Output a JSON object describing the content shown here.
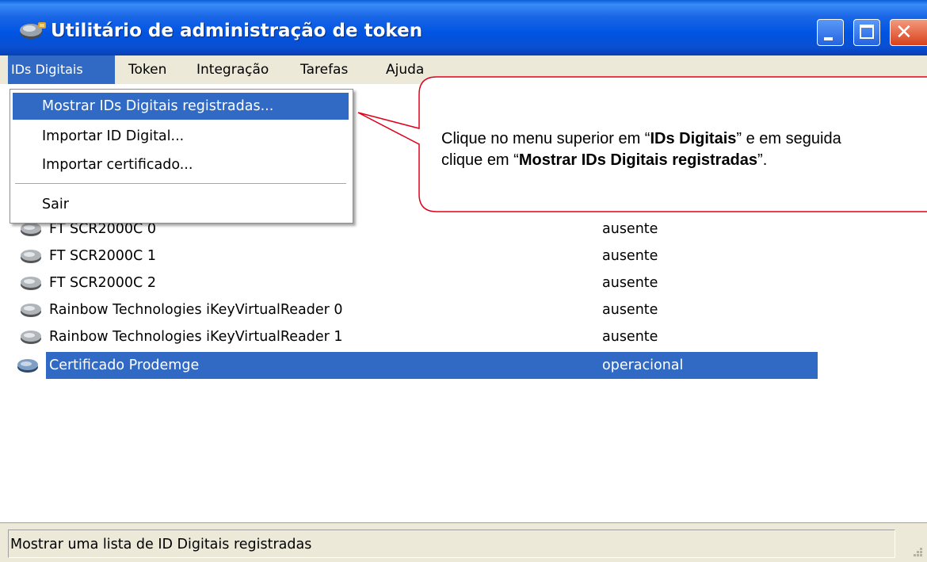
{
  "window": {
    "title": "Utilitário de administração de token"
  },
  "menubar": {
    "items": [
      {
        "label": "IDs Digitais"
      },
      {
        "label": "Token"
      },
      {
        "label": "Integração"
      },
      {
        "label": "Tarefas"
      },
      {
        "label": "Ajuda"
      }
    ]
  },
  "dropdown": {
    "items": [
      {
        "label": "Mostrar IDs Digitais registradas..."
      },
      {
        "label": "Importar ID Digital..."
      },
      {
        "label": "Importar certificado..."
      },
      {
        "label": "Sair"
      }
    ]
  },
  "readers": [
    {
      "name": "FT SCR2000C 0",
      "status": "ausente"
    },
    {
      "name": "FT SCR2000C 1",
      "status": "ausente"
    },
    {
      "name": "FT SCR2000C 2",
      "status": "ausente"
    },
    {
      "name": "Rainbow Technologies iKeyVirtualReader 0",
      "status": "ausente"
    },
    {
      "name": "Rainbow Technologies iKeyVirtualReader 1",
      "status": "ausente"
    },
    {
      "name": "Certificado Prodemge",
      "status": "operacional"
    }
  ],
  "statusbar": {
    "text": "Mostrar uma lista de ID Digitais registradas"
  },
  "callout": {
    "line1_a": "Clique no menu superior em “",
    "line1_b": "IDs Digitais",
    "line1_c": "” e em seguida",
    "line2_a": "clique em “",
    "line2_b": "Mostrar IDs Digitais registradas",
    "line2_c": "”."
  },
  "colors": {
    "titlebar": "#0054e3",
    "selection": "#316ac5",
    "callout_border": "#e0001b",
    "chrome": "#ece9d8"
  }
}
